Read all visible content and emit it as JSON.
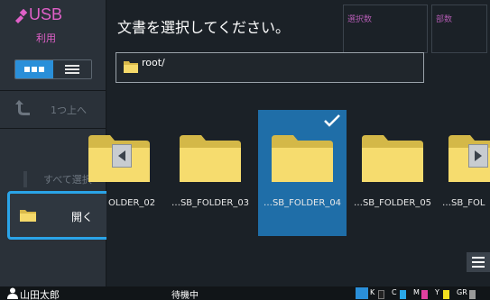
{
  "sidebar": {
    "title": "USB",
    "subtitle": "利用",
    "up_label": "1つ上へ",
    "select_all_label": "すべて選択",
    "open_label": "開く"
  },
  "main": {
    "title": "文書を選択してください。",
    "selected_count_label": "選択数",
    "pages_label": "部数",
    "path": "root/"
  },
  "folders": [
    {
      "label": "OLDER_02",
      "selected": false
    },
    {
      "label": "…SB_FOLDER_03",
      "selected": false
    },
    {
      "label": "…SB_FOLDER_04",
      "selected": true
    },
    {
      "label": "…SB_FOLDER_05",
      "selected": false
    },
    {
      "label": "…SB_FOL",
      "selected": false
    }
  ],
  "statusbar": {
    "user": "山田太郎",
    "status": "待機中",
    "inks": [
      {
        "letter": "K",
        "color": "#222222"
      },
      {
        "letter": "C",
        "color": "#2aa8e8"
      },
      {
        "letter": "M",
        "color": "#e040a0"
      },
      {
        "letter": "Y",
        "color": "#f2e020"
      },
      {
        "letter": "GR",
        "color": "#9a9a9a"
      }
    ]
  },
  "colors": {
    "accent": "#2a8fd9",
    "usb_magenta": "#e060c8",
    "folder_yellow": "#f5d96a",
    "selection_blue": "#1f6ea8"
  }
}
